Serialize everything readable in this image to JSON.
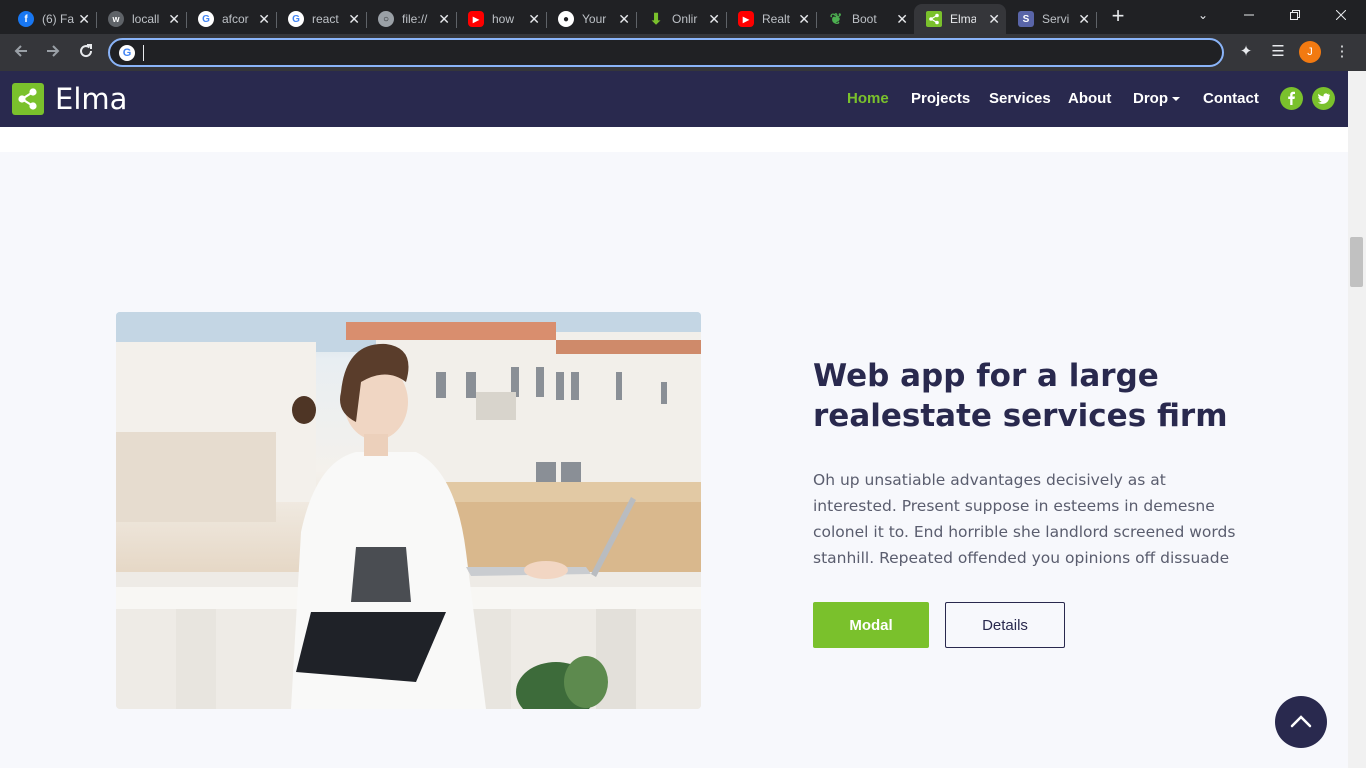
{
  "browser": {
    "tabs": [
      {
        "title": "(6) Fa",
        "favicon": "facebook-icon",
        "color": "#1877f2",
        "glyph": "f"
      },
      {
        "title": "locall",
        "favicon": "localhost-icon",
        "color": "#5f6368",
        "glyph": "w"
      },
      {
        "title": "afcor",
        "favicon": "google-icon",
        "color": "#ffffff",
        "glyph": "G"
      },
      {
        "title": "react",
        "favicon": "google-icon",
        "color": "#ffffff",
        "glyph": "G"
      },
      {
        "title": "file://",
        "favicon": "globe-icon",
        "color": "#9aa0a6",
        "glyph": "○"
      },
      {
        "title": "how",
        "favicon": "youtube-icon",
        "color": "#ff0000",
        "glyph": "▶"
      },
      {
        "title": "Your",
        "favicon": "github-icon",
        "color": "#ffffff",
        "glyph": "●"
      },
      {
        "title": "Onlir",
        "favicon": "download-icon",
        "color": "#7ac12c",
        "glyph": "↓"
      },
      {
        "title": "Realt",
        "favicon": "youtube-icon",
        "color": "#ff0000",
        "glyph": "▶"
      },
      {
        "title": "Boot",
        "favicon": "leaf-icon",
        "color": "#4caf50",
        "glyph": "❦"
      },
      {
        "title": "Elma",
        "favicon": "share-icon",
        "color": "#7ac12c",
        "glyph": "<",
        "active": true
      },
      {
        "title": "Servi",
        "favicon": "s-icon",
        "color": "#5965a8",
        "glyph": "S"
      }
    ],
    "close_glyph": "✕",
    "new_tab_glyph": "+",
    "address_value": "",
    "profile_initial": "J"
  },
  "site": {
    "brand": "Elma",
    "nav": [
      {
        "label": "Home",
        "active": true
      },
      {
        "label": "Projects"
      },
      {
        "label": "Services"
      },
      {
        "label": "About"
      },
      {
        "label": "Drop",
        "dropdown": true
      },
      {
        "label": "Contact"
      }
    ],
    "social": [
      "facebook-icon",
      "twitter-icon"
    ],
    "accent_color": "#7ac12c",
    "navy_color": "#29294e"
  },
  "feature": {
    "heading": "Web app for a large realestate services firm",
    "paragraph": "Oh up unsatiable advantages decisively as at interested. Present suppose in esteems in demesne colonel it to. End horrible she landlord screened words stanhill. Repeated offended you opinions off dissuade",
    "primary_button": "Modal",
    "secondary_button": "Details"
  }
}
